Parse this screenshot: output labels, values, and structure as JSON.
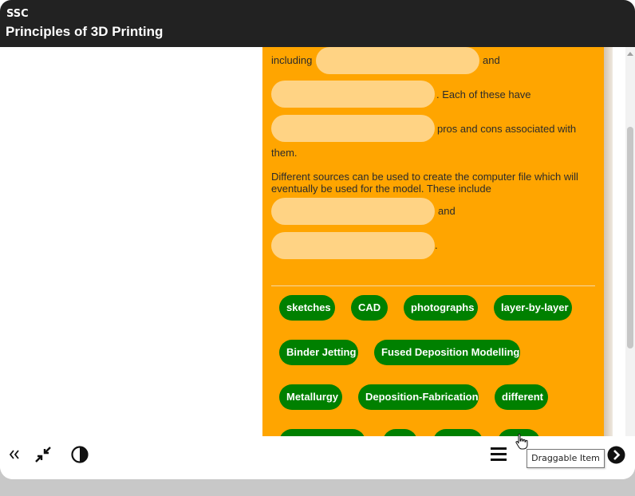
{
  "header": {
    "org": "SSC",
    "course_title": "Principles of 3D Printing"
  },
  "content": {
    "line1_prefix": "including",
    "line1_suffix": "and",
    "line2_suffix": ". Each of these have",
    "line3_suffix": "pros and cons associated with",
    "line4": "them.",
    "paragraph2": "Different sources can be used to create the computer file which will eventually be used for the model. These include",
    "line5_suffix": "and",
    "line6_suffix": "."
  },
  "draggable_items": [
    "sketches",
    "CAD",
    "photographs",
    "layer-by-layer",
    "Binder Jetting",
    "Fused Deposition Modelling",
    "Metallurgy",
    "Deposition-Fabrication",
    "different",
    "",
    "",
    "models",
    "JPEG"
  ],
  "tooltip": "Draggable Item",
  "colors": {
    "panel": "#ffa500",
    "blank": "#ffd384",
    "chip": "#008000",
    "titlebar": "#222222"
  }
}
